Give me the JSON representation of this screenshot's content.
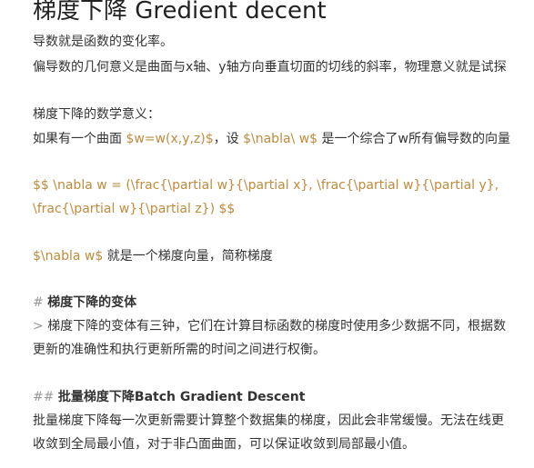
{
  "document": {
    "title": "梯度下降 Gredient decent",
    "lines": {
      "l1": "导数就是函数的变化率。",
      "l2": "偏导数的几何意义是曲面与x轴、y轴方向垂直切面的切线的斜率，物理意义就是试探",
      "l3": "梯度下降的数学意义：",
      "l4_plain_a": "如果有一个曲面 ",
      "l4_math_a": "$w=w(x,y,z)$",
      "l4_plain_b": "，设 ",
      "l4_math_b": "$\\nabla\\ w$",
      "l4_plain_c": " 是一个综合了w所有偏导数的向量",
      "l5a": "$$ \\nabla w = (\\frac{\\partial w}{\\partial x}, \\frac{\\partial w}{\\partial y},",
      "l5b": "\\frac{\\partial w}{\\partial z}) $$",
      "l6_math": "$\\nabla w$",
      "l6_plain": " 就是一个梯度向量，简称梯度",
      "h1_marker": "# ",
      "h1_text": "梯度下降的变体",
      "q_marker": "> ",
      "q1": "梯度下降的变体有三钟，它们在计算目标函数的梯度时使用多少数据不同，根据数",
      "q2": "更新的准确性和执行更新所需的时间之间进行权衡。",
      "h2_marker": "## ",
      "h2_text": "批量梯度下降Batch Gradient Descent",
      "p1": "批量梯度下降每一次更新需要计算整个数据集的梯度，因此会非常缓慢。无法在线更",
      "p2": "收敛到全局最小值，对于非凸面曲面，可以保证收敛到局部最小值。"
    }
  },
  "colors": {
    "text": "#333333",
    "accent": "#c18b3d",
    "markdown_marker": "#999999",
    "background": "#ffffff"
  }
}
